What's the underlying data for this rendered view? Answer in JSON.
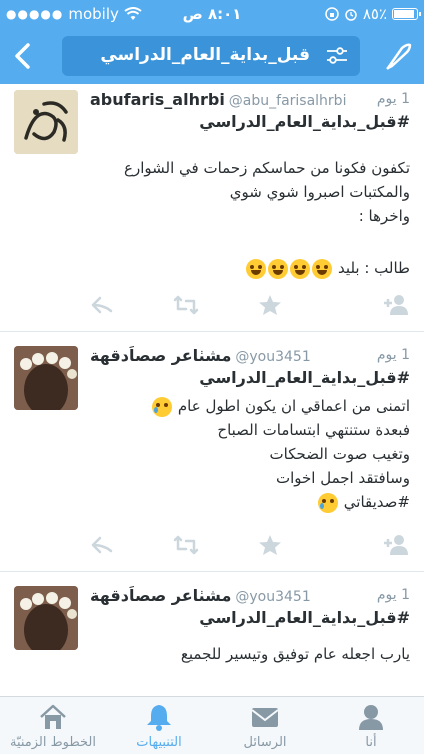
{
  "status_bar": {
    "carrier": "mobily",
    "time": "٨:٠١ ص",
    "battery": "٨٥٪",
    "battery_level": 0.85
  },
  "nav": {
    "search_query": "قبل_بداية_العام_الدراسي"
  },
  "tweets": [
    {
      "name": "abufaris_alhrbi",
      "handle": "@abu_farisalhrbi",
      "time": "1 يوم",
      "hashtag": "#قبل_بداية_العام_الدراسي",
      "lines": [
        "تكفون فكونا من حماسكم زحمات في الشوارع",
        "والمكتبات اصبروا شوي شوي",
        "واخرها :"
      ],
      "last_line_text": "طالب : بليد",
      "emoji": "laugh"
    },
    {
      "name": "مشٺاعر صصاَدقهة",
      "handle": "@you3451",
      "time": "1 يوم",
      "hashtag": "#قبل_بداية_العام_الدراسي",
      "lines": [
        "اتمنى من اعماقي ان يكون اطول عام",
        "فبعدة ستنتهي ابتسامات الصباح",
        "وتغيب صوت الضحكات",
        "وسافتقد اجمل اخوات"
      ],
      "last_line_text": "#صديقاتي",
      "emoji": "cry"
    },
    {
      "name": "مشٺاعر صصاَدقهة",
      "handle": "@you3451",
      "time": "1 يوم",
      "hashtag": "#قبل_بداية_العام_الدراسي",
      "lines": [
        "يارب اجعله عام توفيق وتيسير للجميع"
      ]
    }
  ],
  "tabs": [
    {
      "label": "الخطوط الزمنيّة",
      "icon": "home-icon",
      "active": false
    },
    {
      "label": "التنبيهات",
      "icon": "bell-icon",
      "active": true
    },
    {
      "label": "الرسائل",
      "icon": "envelope-icon",
      "active": false
    },
    {
      "label": "أنا",
      "icon": "person-icon",
      "active": false
    }
  ],
  "colors": {
    "brand": "#55acee",
    "search_bg": "#3b94d9",
    "muted": "#8899a6",
    "action_icon": "#ccd6dd"
  }
}
